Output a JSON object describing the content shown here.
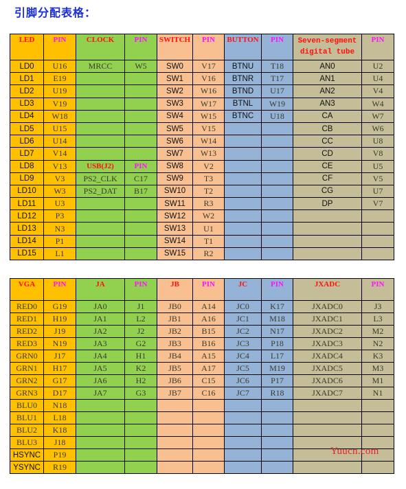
{
  "title": "引脚分配表格：",
  "watermark": "Yuucn.com",
  "colors": {
    "orange": "#ffc000",
    "green": "#92d050",
    "peach": "#f8c090",
    "blue": "#95b3d7",
    "tan": "#c4bd97",
    "header_red": "#ff1010",
    "header_magenta": "#ff10ff",
    "title_blue": "#1b2fd6"
  },
  "table1": {
    "headers": [
      "LED",
      "PIN",
      "CLOCK",
      "PIN",
      "SWITCH",
      "PIN",
      "BUTTON",
      "PIN",
      "Seven-segment digital tube",
      "PIN"
    ],
    "rows": [
      [
        "LD0",
        "U16",
        "MRCC",
        "W5",
        "SW0",
        "V17",
        "BTNU",
        "T18",
        "AN0",
        "U2"
      ],
      [
        "LD1",
        "E19",
        "",
        "",
        "SW1",
        "V16",
        "BTNR",
        "T17",
        "AN1",
        "U4"
      ],
      [
        "LD2",
        "U19",
        "",
        "",
        "SW2",
        "W16",
        "BTND",
        "U17",
        "AN2",
        "V4"
      ],
      [
        "LD3",
        "V19",
        "",
        "",
        "SW3",
        "W17",
        "BTNL",
        "W19",
        "AN3",
        "W4"
      ],
      [
        "LD4",
        "W18",
        "",
        "",
        "SW4",
        "W15",
        "BTNC",
        "U18",
        "CA",
        "W7"
      ],
      [
        "LD5",
        "U15",
        "",
        "",
        "SW5",
        "V15",
        "",
        "",
        "CB",
        "W6"
      ],
      [
        "LD6",
        "U14",
        "",
        "",
        "SW6",
        "W14",
        "",
        "",
        "CC",
        "U8"
      ],
      [
        "LD7",
        "V14",
        "",
        "",
        "SW7",
        "W13",
        "",
        "",
        "CD",
        "V8"
      ],
      [
        "LD8",
        "V13",
        "USB(J2)",
        "PIN",
        "SW8",
        "V2",
        "",
        "",
        "CE",
        "U5"
      ],
      [
        "LD9",
        "V3",
        "PS2_CLK",
        "C17",
        "SW9",
        "T3",
        "",
        "",
        "CF",
        "V5"
      ],
      [
        "LD10",
        "W3",
        "PS2_DAT",
        "B17",
        "SW10",
        "T2",
        "",
        "",
        "CG",
        "U7"
      ],
      [
        "LD11",
        "U3",
        "",
        "",
        "SW11",
        "R3",
        "",
        "",
        "DP",
        "V7"
      ],
      [
        "LD12",
        "P3",
        "",
        "",
        "SW12",
        "W2",
        "",
        "",
        "",
        ""
      ],
      [
        "LD13",
        "N3",
        "",
        "",
        "SW13",
        "U1",
        "",
        "",
        "",
        ""
      ],
      [
        "LD14",
        "P1",
        "",
        "",
        "SW14",
        "T1",
        "",
        "",
        "",
        ""
      ],
      [
        "LD15",
        "L1",
        "",
        "",
        "SW15",
        "R2",
        "",
        "",
        "",
        ""
      ]
    ]
  },
  "table2": {
    "headers": [
      "VGA",
      "PIN",
      "JA",
      "PIN",
      "JB",
      "PIN",
      "JC",
      "PIN",
      "JXADC",
      "PIN"
    ],
    "rows": [
      [
        "RED0",
        "G19",
        "JA0",
        "J1",
        "JB0",
        "A14",
        "JC0",
        "K17",
        "JXADC0",
        "J3"
      ],
      [
        "RED1",
        "H19",
        "JA1",
        "L2",
        "JB1",
        "A16",
        "JC1",
        "M18",
        "JXADC1",
        "L3"
      ],
      [
        "RED2",
        "J19",
        "JA2",
        "J2",
        "JB2",
        "B15",
        "JC2",
        "N17",
        "JXADC2",
        "M2"
      ],
      [
        "RED3",
        "N19",
        "JA3",
        "G2",
        "JB3",
        "B16",
        "JC3",
        "P18",
        "JXADC3",
        "N2"
      ],
      [
        "GRN0",
        "J17",
        "JA4",
        "H1",
        "JB4",
        "A15",
        "JC4",
        "L17",
        "JXADC4",
        "K3"
      ],
      [
        "GRN1",
        "H17",
        "JA5",
        "K2",
        "JB5",
        "A17",
        "JC5",
        "M19",
        "JXADC5",
        "M3"
      ],
      [
        "GRN2",
        "G17",
        "JA6",
        "H2",
        "JB6",
        "C15",
        "JC6",
        "P17",
        "JXADC6",
        "M1"
      ],
      [
        "GRN3",
        "D17",
        "JA7",
        "G3",
        "JB7",
        "C16",
        "JC7",
        "R18",
        "JXADC7",
        "N1"
      ],
      [
        "BLU0",
        "N18",
        "",
        "",
        "",
        "",
        "",
        "",
        "",
        ""
      ],
      [
        "BLU1",
        "L18",
        "",
        "",
        "",
        "",
        "",
        "",
        "",
        ""
      ],
      [
        "BLU2",
        "K18",
        "",
        "",
        "",
        "",
        "",
        "",
        "",
        ""
      ],
      [
        "BLU3",
        "J18",
        "",
        "",
        "",
        "",
        "",
        "",
        "",
        ""
      ],
      [
        "HSYNC",
        "P19",
        "",
        "",
        "",
        "",
        "",
        "",
        "",
        ""
      ],
      [
        "YSYNC",
        "R19",
        "",
        "",
        "",
        "",
        "",
        "",
        "",
        ""
      ]
    ]
  }
}
